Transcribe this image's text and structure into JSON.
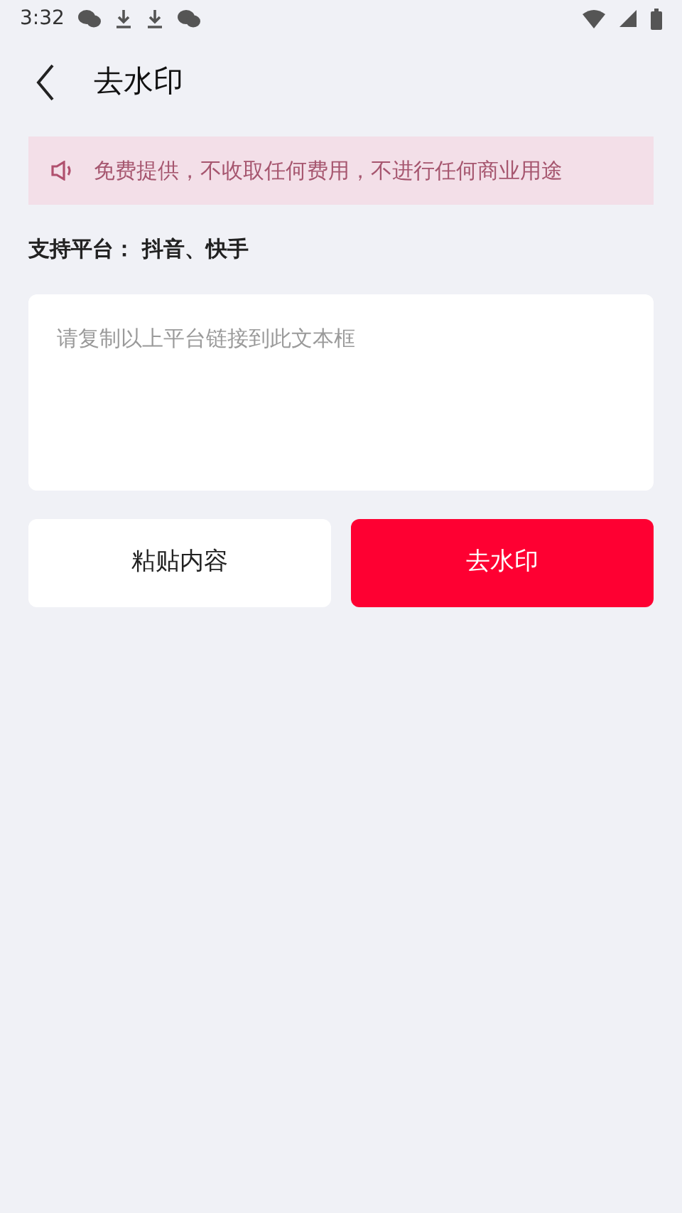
{
  "status_bar": {
    "time": "3:32"
  },
  "header": {
    "title": "去水印"
  },
  "notice": {
    "text": "免费提供，不收取任何费用，不进行任何商业用途"
  },
  "platforms": {
    "text": "支持平台： 抖音、快手"
  },
  "link_field": {
    "placeholder": "请复制以上平台链接到此文本框"
  },
  "buttons": [
    {
      "label": "粘贴内容",
      "kind": "secondary"
    },
    {
      "label": "去水印",
      "kind": "primary"
    }
  ]
}
